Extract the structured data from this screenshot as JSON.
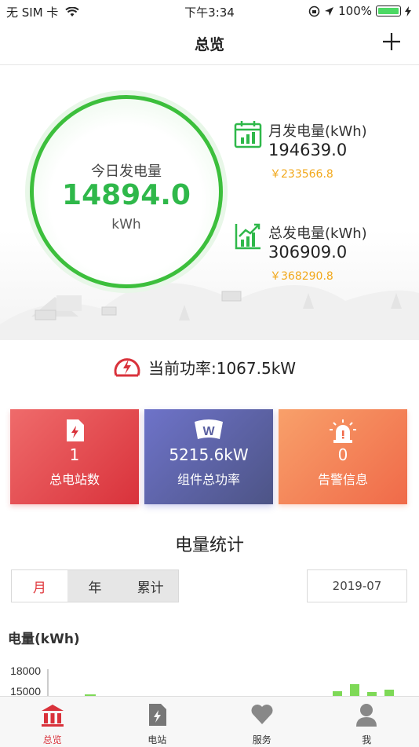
{
  "status_bar": {
    "carrier": "无 SIM 卡",
    "time": "下午3:34",
    "battery": "100%"
  },
  "nav": {
    "title": "总览"
  },
  "today": {
    "label": "今日发电量",
    "value": "14894.0",
    "unit": "kWh"
  },
  "monthly": {
    "label": "月发电量(kWh)",
    "value": "194639.0",
    "money": "￥233566.8"
  },
  "total": {
    "label": "总发电量(kWh)",
    "value": "306909.0",
    "money": "￥368290.8"
  },
  "power": {
    "label": "当前功率:1067.5kW"
  },
  "cards": [
    {
      "value": "1",
      "label": "总电站数"
    },
    {
      "value": "5215.6kW",
      "label": "组件总功率"
    },
    {
      "value": "0",
      "label": "告警信息"
    }
  ],
  "stats": {
    "title": "电量统计",
    "tabs": [
      "月",
      "年",
      "累计"
    ],
    "date": "2019-07",
    "ylabel": "电量(kWh)",
    "ticks": [
      "18000",
      "15000"
    ]
  },
  "tabbar": [
    "总览",
    "电站",
    "服务",
    "我"
  ],
  "colors": {
    "accent_red": "#d9323b",
    "green": "#2fb84a",
    "gold": "#f2a81b"
  }
}
